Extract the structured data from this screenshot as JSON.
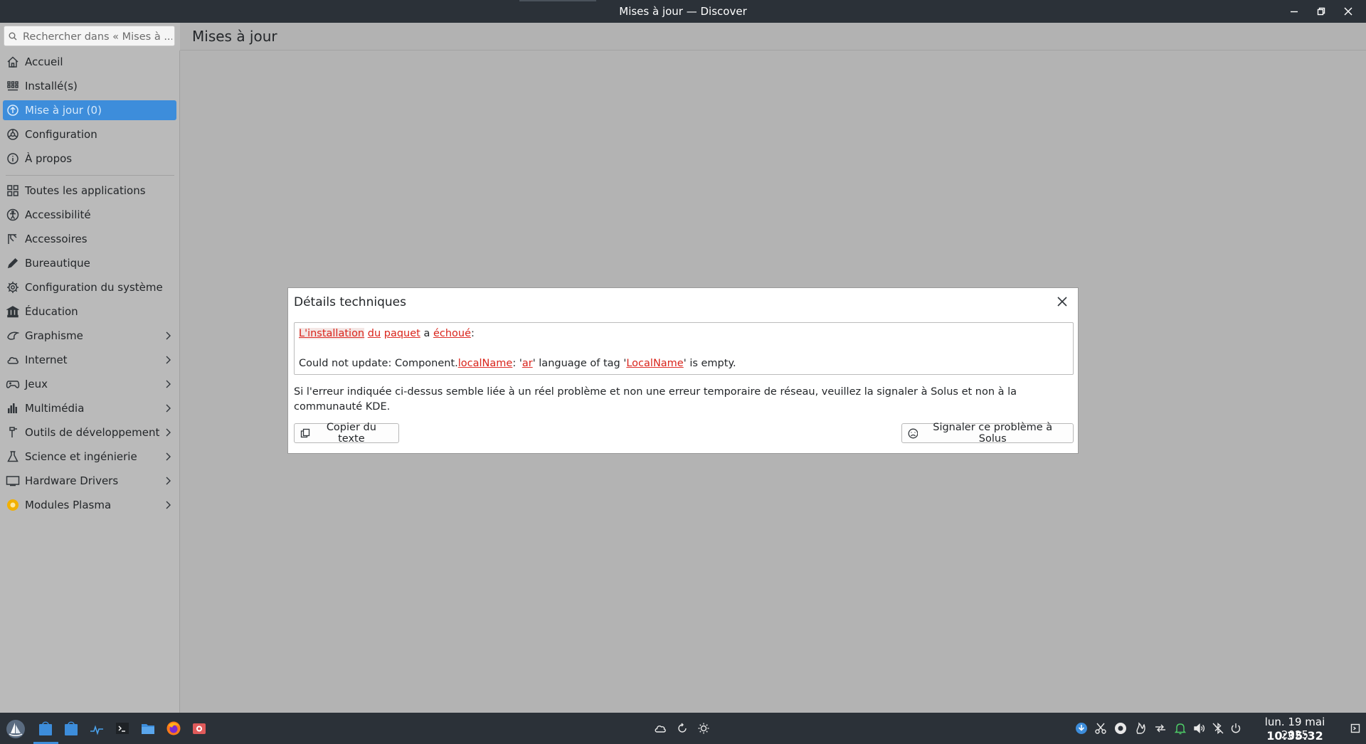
{
  "window": {
    "title": "Mises à jour — Discover"
  },
  "search": {
    "placeholder": "Rechercher dans « Mises à ..."
  },
  "header": {
    "page_title": "Mises à jour"
  },
  "sidebar": {
    "top_items": [
      {
        "label": "Accueil",
        "icon": "home-icon"
      },
      {
        "label": "Installé(s)",
        "icon": "installed-grid-icon"
      },
      {
        "label": "Mise à jour (0)",
        "icon": "update-arrow-icon",
        "active": true
      },
      {
        "label": "Configuration",
        "icon": "settings-icon"
      },
      {
        "label": "À propos",
        "icon": "info-icon"
      }
    ],
    "categories": [
      {
        "label": "Toutes les applications",
        "icon": "all-apps-icon"
      },
      {
        "label": "Accessibilité",
        "icon": "accessibility-icon"
      },
      {
        "label": "Accessoires",
        "icon": "accessories-icon"
      },
      {
        "label": "Bureautique",
        "icon": "pencil-icon"
      },
      {
        "label": "Configuration du système",
        "icon": "system-settings-icon"
      },
      {
        "label": "Éducation",
        "icon": "education-icon"
      },
      {
        "label": "Graphisme",
        "icon": "graphics-icon",
        "submenu": true
      },
      {
        "label": "Internet",
        "icon": "cloud-icon",
        "submenu": true
      },
      {
        "label": "Jeux",
        "icon": "gamepad-icon",
        "submenu": true
      },
      {
        "label": "Multimédia",
        "icon": "multimedia-icon",
        "submenu": true
      },
      {
        "label": "Outils de développement",
        "icon": "dev-tools-icon",
        "submenu": true
      },
      {
        "label": "Science et ingénierie",
        "icon": "flask-icon",
        "submenu": true
      },
      {
        "label": "Hardware Drivers",
        "icon": "monitor-icon",
        "submenu": true
      },
      {
        "label": "Modules Plasma",
        "icon": "plasma-icon",
        "submenu": true
      }
    ]
  },
  "dialog": {
    "title": "Détails techniques",
    "error": {
      "w1": "L'installation",
      "w2": "du",
      "w3": "paquet",
      "w4": "a",
      "w5": "échoué",
      "colon": ":",
      "l2_a": "Could not update: Component.",
      "l2_b": "localName",
      "l2_c": ": '",
      "l2_d": "ar",
      "l2_e": "' language of tag '",
      "l2_f": "LocalName",
      "l2_g": "' is empty."
    },
    "report_text": "Si l'erreur indiquée ci-dessus semble liée à un réel problème et non une erreur temporaire de réseau, veuillez la signaler à Solus et non à la communauté KDE.",
    "copy_button": "Copier du texte",
    "report_button": "Signaler ce problème à Solus"
  },
  "taskbar": {
    "date": "lun. 19 mai 2025",
    "time": "10:35:32"
  },
  "colors": {
    "accent": "#3d8ddb",
    "titlebar": "#2b3138",
    "spelling_error": "#e0302a"
  }
}
